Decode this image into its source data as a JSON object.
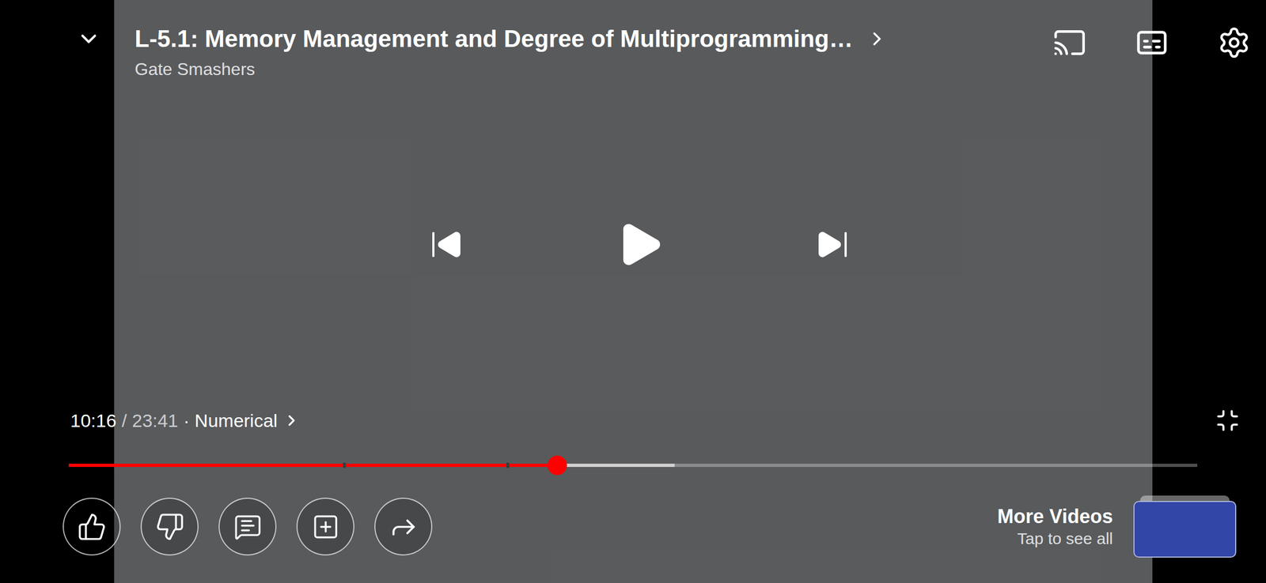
{
  "video": {
    "title": "L-5.1: Memory Management and Degree of Multiprogramming…",
    "channel": "Gate Smashers",
    "playing": false
  },
  "time": {
    "elapsed": "10:16",
    "duration": "/ 23:41",
    "chapter": "· Numerical"
  },
  "progress": {
    "level": 0.433,
    "buffered": 0.537,
    "chapter_marks": [
      0.243,
      0.388
    ]
  },
  "more_videos": {
    "label": "More Videos",
    "hint": "Tap to see all"
  }
}
